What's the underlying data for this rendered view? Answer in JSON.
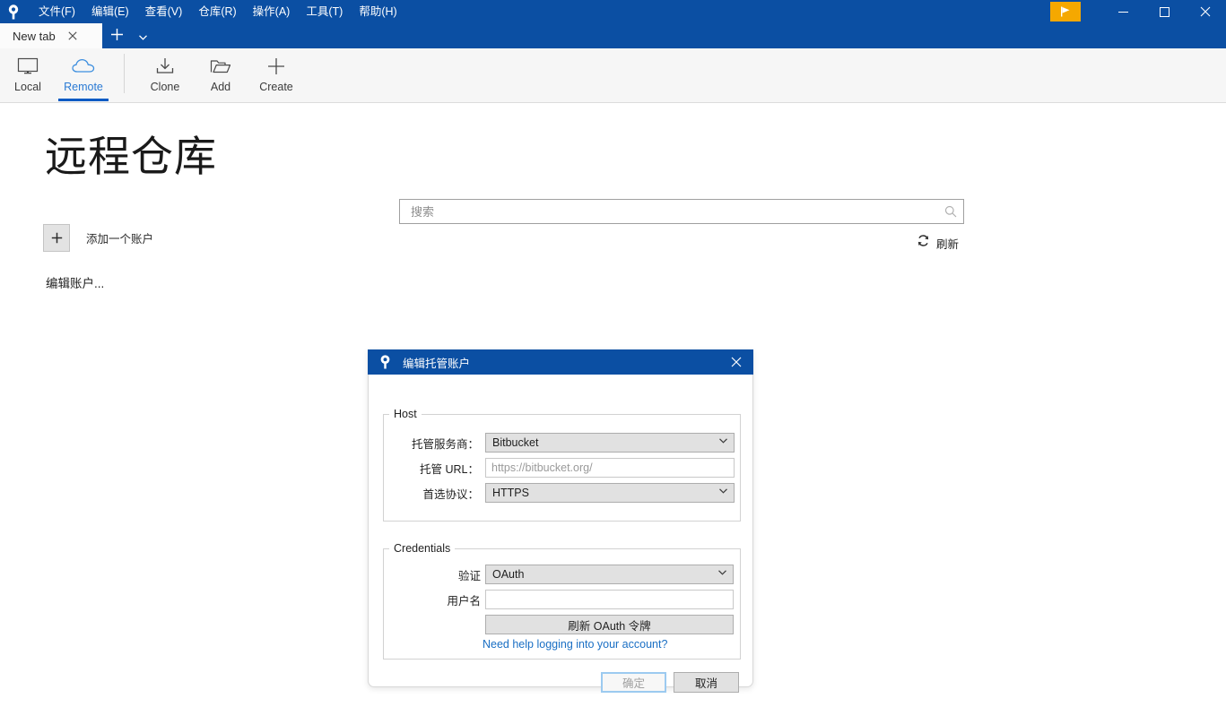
{
  "window": {
    "app_icon": "sourcetree-logo-icon",
    "menu": [
      {
        "label": "文件(F)"
      },
      {
        "label": "编辑(E)"
      },
      {
        "label": "查看(V)"
      },
      {
        "label": "仓库(R)"
      },
      {
        "label": "操作(A)"
      },
      {
        "label": "工具(T)"
      },
      {
        "label": "帮助(H)"
      }
    ],
    "flag_button_icon": "flag-icon",
    "minimize_icon": "minimize-icon",
    "maximize_icon": "maximize-icon",
    "close_icon": "close-icon",
    "colors": {
      "titlebar": "#0b4fa3",
      "accent_orange": "#f5a800",
      "link_blue": "#1a6fc4",
      "active_tab_blue": "#0b5bc4"
    }
  },
  "tabs": {
    "items": [
      {
        "label": "New tab",
        "close_icon": "close-icon"
      }
    ],
    "new_tab_icon": "plus-icon",
    "tab_list_caret_icon": "chevron-down-icon"
  },
  "toolbar": {
    "left_group": [
      {
        "label": "Local",
        "icon": "monitor-icon",
        "active": false
      },
      {
        "label": "Remote",
        "icon": "cloud-icon",
        "active": true
      }
    ],
    "right_group": [
      {
        "label": "Clone",
        "icon": "download-icon"
      },
      {
        "label": "Add",
        "icon": "folder-icon"
      },
      {
        "label": "Create",
        "icon": "plus-icon"
      }
    ]
  },
  "main": {
    "page_title": "远程仓库",
    "add_account": {
      "plus_icon": "plus-icon",
      "label": "添加一个账户"
    },
    "edit_accounts_link": "编辑账户...",
    "search": {
      "placeholder": "搜索",
      "value": "",
      "icon": "search-icon"
    },
    "refresh": {
      "label": "刷新",
      "icon": "refresh-icon"
    }
  },
  "dialog": {
    "icon": "sourcetree-logo-icon",
    "title": "编辑托管账户",
    "close_icon": "close-icon",
    "host_group": {
      "legend": "Host",
      "provider": {
        "label": "托管服务商：",
        "value": "Bitbucket",
        "caret_icon": "chevron-down-icon"
      },
      "url": {
        "label": "托管 URL：",
        "value": "",
        "placeholder": "https://bitbucket.org/"
      },
      "protocol": {
        "label": "首选协议：",
        "value": "HTTPS",
        "caret_icon": "chevron-down-icon"
      }
    },
    "credentials_group": {
      "legend": "Credentials",
      "auth": {
        "label": "验证",
        "value": "OAuth",
        "caret_icon": "chevron-down-icon"
      },
      "username": {
        "label": "用户名",
        "value": "",
        "placeholder": ""
      },
      "refresh_token_button": "刷新 OAuth 令牌",
      "help_link": "Need help logging into your account?"
    },
    "buttons": {
      "ok": "确定",
      "cancel": "取消"
    }
  }
}
